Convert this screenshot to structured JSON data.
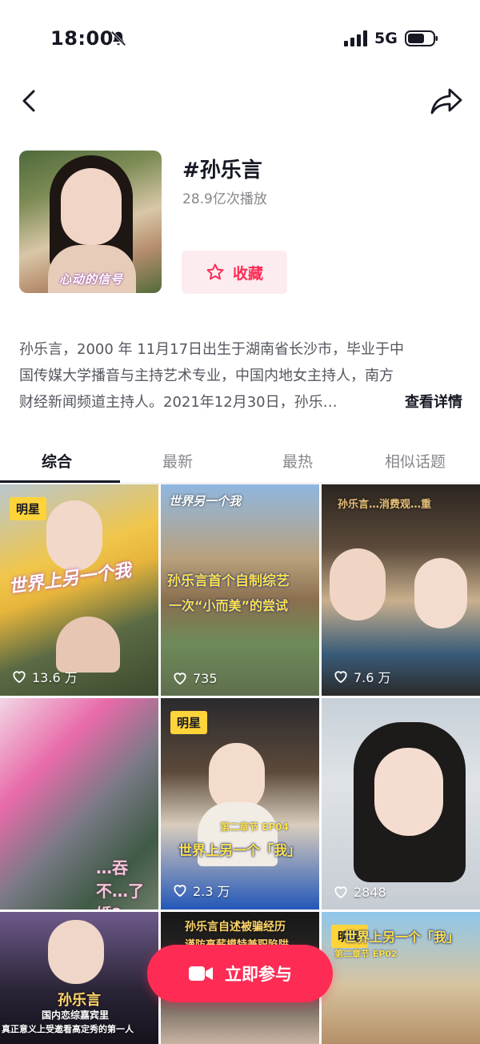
{
  "status_bar": {
    "time": "18:00",
    "network": "5G"
  },
  "topic": {
    "title": "#孙乐言",
    "plays": "28.9亿次播放",
    "cover_caption": "心动的信号",
    "favorite_label": "收藏"
  },
  "description": {
    "lines": [
      "孙乐言，2000 年 11月17日出生于湖南省长沙市，毕业于中",
      "国传媒大学播音与主持艺术专业，中国内地女主持人，南方",
      "财经新闻频道主持人。2021年12月30日，孙乐…"
    ],
    "more_label": "查看详情"
  },
  "tabs": [
    {
      "label": "综合"
    },
    {
      "label": "最新"
    },
    {
      "label": "最热"
    },
    {
      "label": "相似话题"
    }
  ],
  "videos": [
    {
      "badge": "明星",
      "likes": "13.6 万",
      "overlay": "世界上另一个我"
    },
    {
      "badge": "",
      "likes": "735",
      "overlay_top": "世界另一个我",
      "overlay": "孙乐言首个自制综艺",
      "overlay2": "一次“小而美”的尝试"
    },
    {
      "badge": "",
      "likes": "7.6 万",
      "overlay": "孙乐言…消费观…重"
    },
    {
      "badge": "",
      "likes": "",
      "overlay": "…吞不…了婚?"
    },
    {
      "badge": "明星",
      "likes": "2.3 万",
      "overlay_top": "第二章节 EP04",
      "overlay": "世界上另一个「我」"
    },
    {
      "badge": "",
      "likes": "2848",
      "overlay": ""
    },
    {
      "badge": "",
      "likes": "",
      "overlay_top": "孙乐言",
      "overlay": "国内恋综嘉宾里",
      "overlay2": "真正意义上受邀看高定秀的第一人"
    },
    {
      "badge": "",
      "likes": "",
      "overlay_top": "孙乐言自述被骗经历",
      "overlay": "谨防高薪模特兼职陷阱"
    },
    {
      "badge": "明星",
      "likes": "",
      "overlay_top": "第二章节 EP02",
      "overlay": "世界上另一个「我」"
    }
  ],
  "join_button": {
    "label": "立即参与"
  },
  "colors": {
    "accent": "#fe2c55",
    "badge": "#ffd43a",
    "fav_bg": "#fdecef"
  }
}
